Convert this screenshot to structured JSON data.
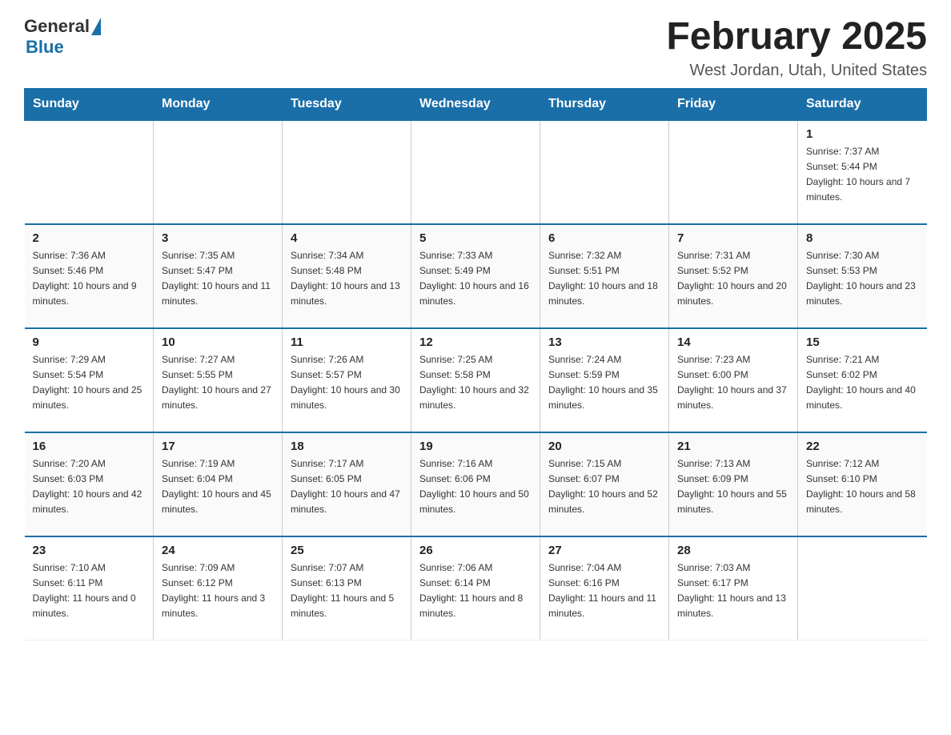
{
  "header": {
    "logo_general": "General",
    "logo_blue": "Blue",
    "title": "February 2025",
    "subtitle": "West Jordan, Utah, United States"
  },
  "days_of_week": [
    "Sunday",
    "Monday",
    "Tuesday",
    "Wednesday",
    "Thursday",
    "Friday",
    "Saturday"
  ],
  "weeks": [
    {
      "cells": [
        {
          "day": "",
          "info": ""
        },
        {
          "day": "",
          "info": ""
        },
        {
          "day": "",
          "info": ""
        },
        {
          "day": "",
          "info": ""
        },
        {
          "day": "",
          "info": ""
        },
        {
          "day": "",
          "info": ""
        },
        {
          "day": "1",
          "info": "Sunrise: 7:37 AM\nSunset: 5:44 PM\nDaylight: 10 hours and 7 minutes."
        }
      ]
    },
    {
      "cells": [
        {
          "day": "2",
          "info": "Sunrise: 7:36 AM\nSunset: 5:46 PM\nDaylight: 10 hours and 9 minutes."
        },
        {
          "day": "3",
          "info": "Sunrise: 7:35 AM\nSunset: 5:47 PM\nDaylight: 10 hours and 11 minutes."
        },
        {
          "day": "4",
          "info": "Sunrise: 7:34 AM\nSunset: 5:48 PM\nDaylight: 10 hours and 13 minutes."
        },
        {
          "day": "5",
          "info": "Sunrise: 7:33 AM\nSunset: 5:49 PM\nDaylight: 10 hours and 16 minutes."
        },
        {
          "day": "6",
          "info": "Sunrise: 7:32 AM\nSunset: 5:51 PM\nDaylight: 10 hours and 18 minutes."
        },
        {
          "day": "7",
          "info": "Sunrise: 7:31 AM\nSunset: 5:52 PM\nDaylight: 10 hours and 20 minutes."
        },
        {
          "day": "8",
          "info": "Sunrise: 7:30 AM\nSunset: 5:53 PM\nDaylight: 10 hours and 23 minutes."
        }
      ]
    },
    {
      "cells": [
        {
          "day": "9",
          "info": "Sunrise: 7:29 AM\nSunset: 5:54 PM\nDaylight: 10 hours and 25 minutes."
        },
        {
          "day": "10",
          "info": "Sunrise: 7:27 AM\nSunset: 5:55 PM\nDaylight: 10 hours and 27 minutes."
        },
        {
          "day": "11",
          "info": "Sunrise: 7:26 AM\nSunset: 5:57 PM\nDaylight: 10 hours and 30 minutes."
        },
        {
          "day": "12",
          "info": "Sunrise: 7:25 AM\nSunset: 5:58 PM\nDaylight: 10 hours and 32 minutes."
        },
        {
          "day": "13",
          "info": "Sunrise: 7:24 AM\nSunset: 5:59 PM\nDaylight: 10 hours and 35 minutes."
        },
        {
          "day": "14",
          "info": "Sunrise: 7:23 AM\nSunset: 6:00 PM\nDaylight: 10 hours and 37 minutes."
        },
        {
          "day": "15",
          "info": "Sunrise: 7:21 AM\nSunset: 6:02 PM\nDaylight: 10 hours and 40 minutes."
        }
      ]
    },
    {
      "cells": [
        {
          "day": "16",
          "info": "Sunrise: 7:20 AM\nSunset: 6:03 PM\nDaylight: 10 hours and 42 minutes."
        },
        {
          "day": "17",
          "info": "Sunrise: 7:19 AM\nSunset: 6:04 PM\nDaylight: 10 hours and 45 minutes."
        },
        {
          "day": "18",
          "info": "Sunrise: 7:17 AM\nSunset: 6:05 PM\nDaylight: 10 hours and 47 minutes."
        },
        {
          "day": "19",
          "info": "Sunrise: 7:16 AM\nSunset: 6:06 PM\nDaylight: 10 hours and 50 minutes."
        },
        {
          "day": "20",
          "info": "Sunrise: 7:15 AM\nSunset: 6:07 PM\nDaylight: 10 hours and 52 minutes."
        },
        {
          "day": "21",
          "info": "Sunrise: 7:13 AM\nSunset: 6:09 PM\nDaylight: 10 hours and 55 minutes."
        },
        {
          "day": "22",
          "info": "Sunrise: 7:12 AM\nSunset: 6:10 PM\nDaylight: 10 hours and 58 minutes."
        }
      ]
    },
    {
      "cells": [
        {
          "day": "23",
          "info": "Sunrise: 7:10 AM\nSunset: 6:11 PM\nDaylight: 11 hours and 0 minutes."
        },
        {
          "day": "24",
          "info": "Sunrise: 7:09 AM\nSunset: 6:12 PM\nDaylight: 11 hours and 3 minutes."
        },
        {
          "day": "25",
          "info": "Sunrise: 7:07 AM\nSunset: 6:13 PM\nDaylight: 11 hours and 5 minutes."
        },
        {
          "day": "26",
          "info": "Sunrise: 7:06 AM\nSunset: 6:14 PM\nDaylight: 11 hours and 8 minutes."
        },
        {
          "day": "27",
          "info": "Sunrise: 7:04 AM\nSunset: 6:16 PM\nDaylight: 11 hours and 11 minutes."
        },
        {
          "day": "28",
          "info": "Sunrise: 7:03 AM\nSunset: 6:17 PM\nDaylight: 11 hours and 13 minutes."
        },
        {
          "day": "",
          "info": ""
        }
      ]
    }
  ]
}
